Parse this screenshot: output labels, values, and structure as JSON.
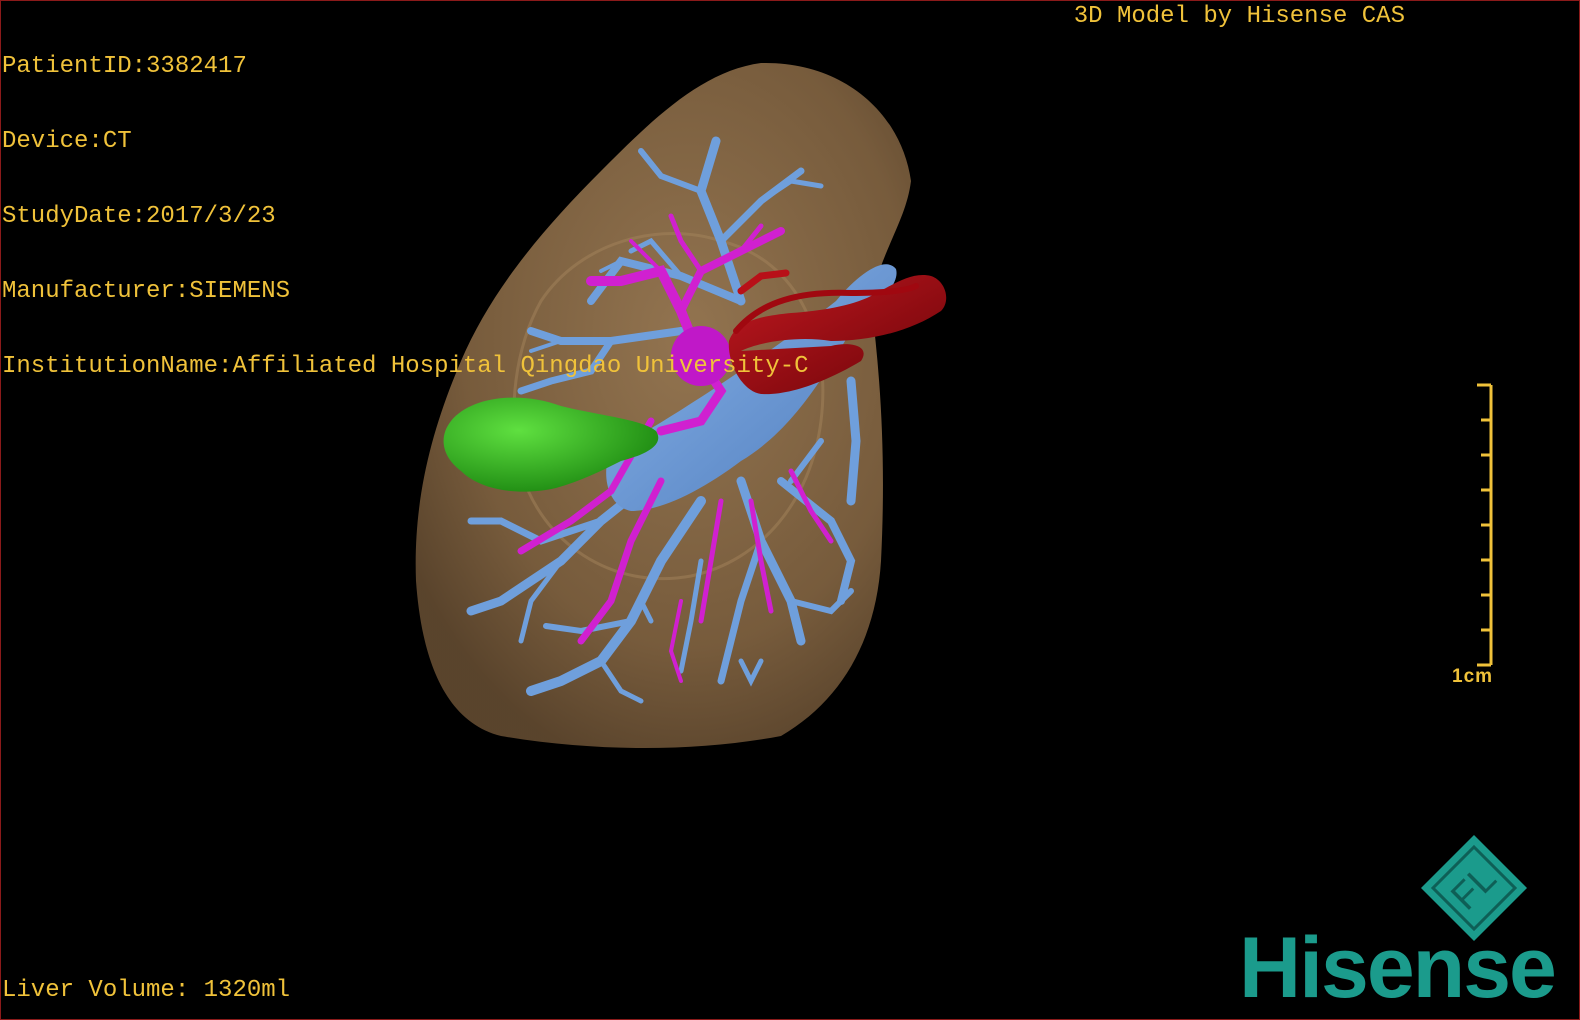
{
  "overlay": {
    "patient_id": "PatientID:3382417",
    "device": "Device:CT",
    "study_date": "StudyDate:2017/3/23",
    "manufacturer": "Manufacturer:SIEMENS",
    "institution": "InstitutionName:Affiliated Hospital Qingdao University-C",
    "model_credit": "3D Model by Hisense CAS",
    "liver_volume": "Liver Volume: 1320ml"
  },
  "scale": {
    "label": "1cm"
  },
  "logo": {
    "emblem_text": "FL",
    "brand": "Hisense"
  },
  "colors": {
    "overlay_text": "#f0c23a",
    "liver": "#8a6a45",
    "portal_vein": "#6f9fdc",
    "hepatic_artery_branches": "#d020d0",
    "artery": "#a00810",
    "gallbladder": "#2fbf1c",
    "brand": "#1b9b8c"
  },
  "icons": {
    "logo_emblem": "fl-diamond-icon"
  }
}
